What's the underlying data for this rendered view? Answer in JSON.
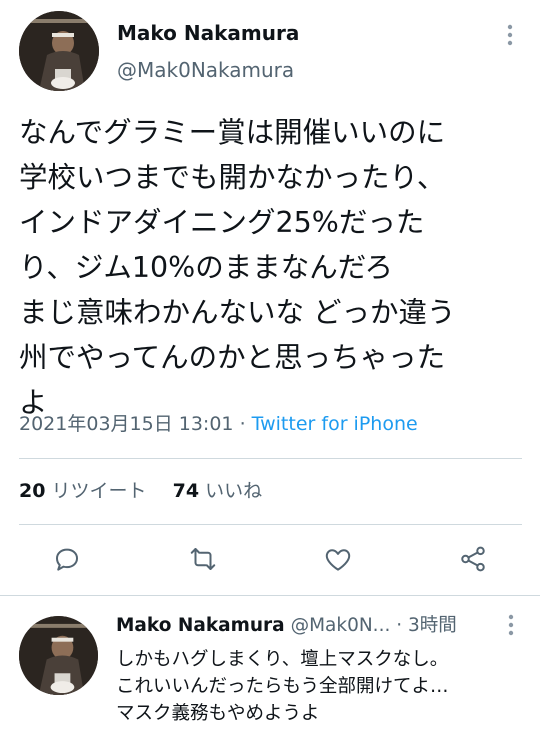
{
  "main_tweet": {
    "author_name": "Mako Nakamura",
    "author_handle": "@Mak0Nakamura",
    "text_lines": [
      "なんでグラミー賞は開催いいのに",
      "学校いつまでも開かなかったり、",
      "インドアダイニング25%だった",
      "り、ジム10%のままなんだろ",
      "まじ意味わかんないな どっか違う",
      "州でやってんのかと思っちゃった",
      "よ"
    ],
    "date": "2021年03月15日 13:01",
    "separator": "·",
    "source": "Twitter for iPhone",
    "retweet_count": "20",
    "retweet_label": "リツイート",
    "like_count": "74",
    "like_label": "いいね"
  },
  "actions": [
    "reply-icon",
    "retweet-icon",
    "like-icon",
    "share-icon"
  ],
  "reply": {
    "author_name": "Mako Nakamura",
    "author_handle": "@Mak0N...",
    "separator": "·",
    "time": "3時間",
    "text_lines": [
      "しかもハグしまくり、壇上マスクなし。",
      "これいいんだったらもう全部開けてよ…",
      "マスク義務もやめようよ"
    ]
  },
  "colors": {
    "accent": "#1d9bf0",
    "text": "#0f1419",
    "muted": "#536471",
    "divider": "#cfd9de"
  }
}
